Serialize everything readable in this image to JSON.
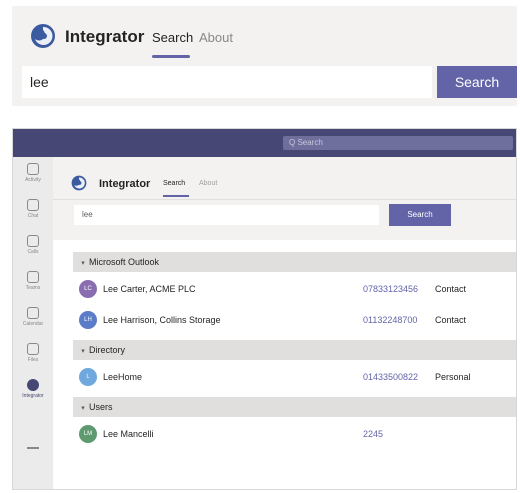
{
  "top": {
    "app_title": "Integrator",
    "tabs": [
      {
        "label": "Search"
      },
      {
        "label": "About"
      }
    ],
    "search_value": "lee",
    "search_button": "Search"
  },
  "teams": {
    "titlebar_search": "Q Search",
    "rail": [
      {
        "label": "Activity",
        "icon": "bell-icon"
      },
      {
        "label": "Chat",
        "icon": "chat-icon"
      },
      {
        "label": "Calls",
        "icon": "phone-icon"
      },
      {
        "label": "Teams",
        "icon": "teams-icon"
      },
      {
        "label": "Calendar",
        "icon": "calendar-icon"
      },
      {
        "label": "Files",
        "icon": "file-icon"
      },
      {
        "label": "Integrator",
        "icon": "integrator-icon"
      }
    ],
    "app_title": "Integrator",
    "tabs": [
      {
        "label": "Search"
      },
      {
        "label": "About"
      }
    ],
    "search_value": "lee",
    "search_button": "Search",
    "groups": [
      {
        "label": "Microsoft Outlook",
        "rows": [
          {
            "initials": "LC",
            "name": "Lee Carter, ACME PLC",
            "phone": "07833123456",
            "type": "Contact",
            "color": "#8a6db1"
          },
          {
            "initials": "LH",
            "name": "Lee Harrison, Collins Storage",
            "phone": "01132248700",
            "type": "Contact",
            "color": "#5b7cc9"
          }
        ]
      },
      {
        "label": "Directory",
        "rows": [
          {
            "initials": "L",
            "name": "LeeHome",
            "phone": "01433500822",
            "type": "Personal",
            "color": "#6fa8dc"
          }
        ]
      },
      {
        "label": "Users",
        "rows": [
          {
            "initials": "LM",
            "name": "Lee Mancelli",
            "phone": "2245",
            "type": "",
            "color": "#5e9a6f"
          }
        ]
      }
    ]
  },
  "colors": {
    "accent": "#6264a7",
    "titlebar": "#464775"
  }
}
